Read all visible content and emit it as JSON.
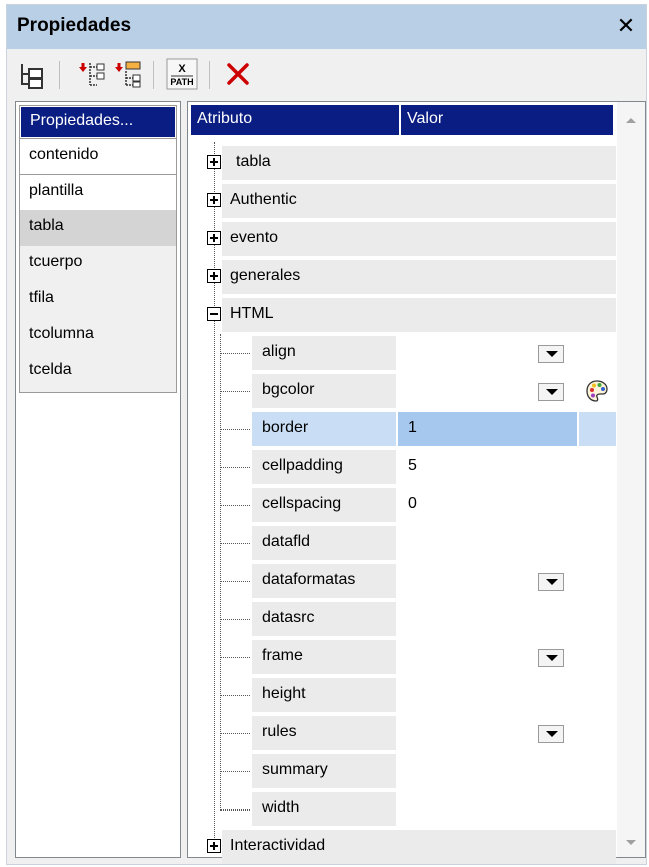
{
  "panel": {
    "title": "Propiedades",
    "close_glyph": "✕"
  },
  "toolbar": {
    "buttons": [
      {
        "name": "tree-layout-icon"
      },
      {
        "name": "insert-element-icon"
      },
      {
        "name": "append-element-icon"
      },
      {
        "name": "xpath-icon",
        "label_top": "X",
        "label_bottom": "PATH"
      },
      {
        "name": "delete-icon"
      }
    ]
  },
  "left": {
    "header": "Propiedades...",
    "items": [
      "contenido",
      "plantilla",
      "tabla",
      "tcuerpo",
      "tfila",
      "tcolumna",
      "tcelda"
    ],
    "selected": "tabla"
  },
  "right": {
    "col_attr": "Atributo",
    "col_val": "Valor",
    "groups": {
      "tabla": "tabla",
      "authentic": "Authentic",
      "evento": "evento",
      "generales": "generales",
      "html": "HTML",
      "interactividad": "Interactividad"
    },
    "rows": [
      {
        "attr": "align",
        "value": "",
        "dropdown": true
      },
      {
        "attr": "bgcolor",
        "value": "",
        "dropdown": true,
        "palette": true
      },
      {
        "attr": "border",
        "value": "1",
        "selected": true
      },
      {
        "attr": "cellpadding",
        "value": "5"
      },
      {
        "attr": "cellspacing",
        "value": "0"
      },
      {
        "attr": "datafld",
        "value": ""
      },
      {
        "attr": "dataformatas",
        "value": "",
        "dropdown": true
      },
      {
        "attr": "datasrc",
        "value": ""
      },
      {
        "attr": "frame",
        "value": "",
        "dropdown": true
      },
      {
        "attr": "height",
        "value": ""
      },
      {
        "attr": "rules",
        "value": "",
        "dropdown": true
      },
      {
        "attr": "summary",
        "value": ""
      },
      {
        "attr": "width",
        "value": ""
      }
    ]
  },
  "colors": {
    "titlebar": "#b9cfe6",
    "header": "#0a1d82",
    "selected_row": "#a7c8ee",
    "delete_red": "#cc0000"
  }
}
